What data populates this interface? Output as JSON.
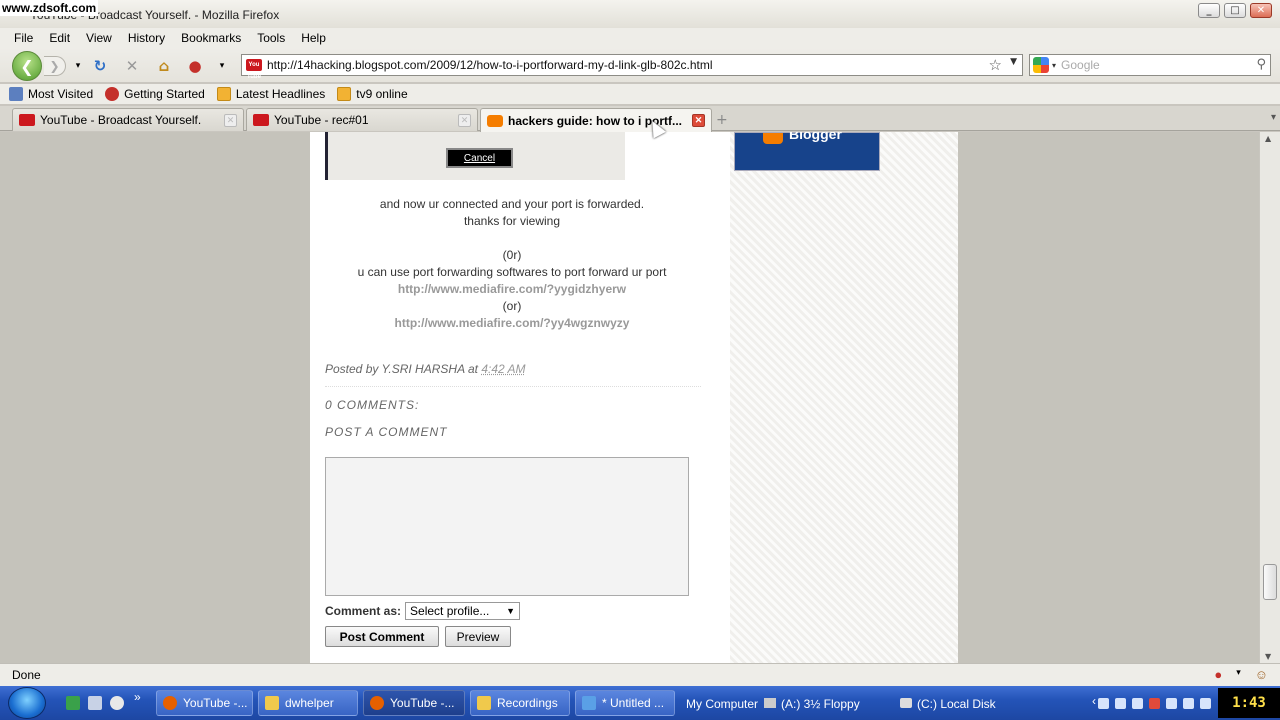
{
  "watermark": "www.zdsoft.com",
  "window": {
    "title": "YouTube - Broadcast Yourself. - Mozilla Firefox"
  },
  "menu": [
    "File",
    "Edit",
    "View",
    "History",
    "Bookmarks",
    "Tools",
    "Help"
  ],
  "address": {
    "url": "http://14hacking.blogspot.com/2009/12/how-to-i-portforward-my-d-link-glb-802c.html",
    "favicon_text": "You Tube"
  },
  "search": {
    "placeholder": "Google"
  },
  "bookmarks": [
    "Most Visited",
    "Getting Started",
    "Latest Headlines",
    "tv9 online"
  ],
  "tabs": [
    {
      "label": "YouTube - Broadcast Yourself."
    },
    {
      "label": "YouTube - rec#01"
    },
    {
      "label": "hackers guide: how to i portf..."
    }
  ],
  "page": {
    "cancel_label": "Cancel",
    "badge_text": "Blogger",
    "body": {
      "line1": "and now ur connected and your port is forwarded.",
      "line2": "thanks for viewing",
      "line3": "(0r)",
      "line4": "u can use port forwarding softwares to port forward ur port",
      "link1": "http://www.mediafire.com/?yygidzhyerw",
      "line5": "(or)",
      "link2": "http://www.mediafire.com/?yy4wgznwyzy"
    },
    "footer": {
      "posted_by": "Posted by Y.SRI HARSHA at",
      "time": "4:42 AM"
    },
    "comments_heading": "0 COMMENTS:",
    "post_comment_heading": "POST A COMMENT",
    "comment_as_label": "Comment as:",
    "profile_select": "Select profile...",
    "post_button": "Post Comment",
    "preview_button": "Preview"
  },
  "status": {
    "text": "Done"
  },
  "taskbar": {
    "tasks": [
      "YouTube -...",
      "dwhelper",
      "YouTube -...",
      "Recordings",
      "* Untitled ..."
    ],
    "my_computer": "My Computer",
    "floppy": "(A:) 3½ Floppy",
    "local_disk": "(C:) Local Disk",
    "clock": "1:43"
  },
  "colors": {
    "accent_blue": "#2454b8",
    "blogger_orange": "#f57d00",
    "youtube_red": "#cc181e"
  }
}
